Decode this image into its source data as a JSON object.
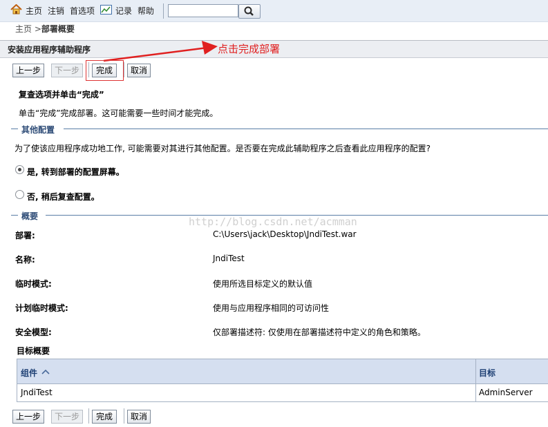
{
  "topnav": {
    "home": "主页",
    "logout": "注销",
    "preferences": "首选项",
    "record": "记录",
    "help": "帮助",
    "search_value": ""
  },
  "breadcrumb": {
    "home": "主页",
    "separator": ">",
    "current": "部署概要"
  },
  "page_title": "安装应用程序辅助程序",
  "annotation": "点击完成部署",
  "buttons": {
    "back": "上一步",
    "next": "下一步",
    "finish": "完成",
    "cancel": "取消"
  },
  "review": {
    "heading": "复查选项并单击“完成”",
    "text": "单击“完成”完成部署。这可能需要一些时间才能完成。"
  },
  "other_config": {
    "legend": "其他配置",
    "question": "为了使该应用程序成功地工作, 可能需要对其进行其他配置。是否要在完成此辅助程序之后查看此应用程序的配置?",
    "option_yes": "是, 转到部署的配置屏幕。",
    "option_no": "否, 稍后复查配置。",
    "selected": "yes"
  },
  "watermark": "http://blog.csdn.net/acmman",
  "summary": {
    "legend": "概要",
    "rows": [
      {
        "label": "部署:",
        "value": "C:\\Users\\jack\\Desktop\\JndiTest.war"
      },
      {
        "label": "名称:",
        "value": "JndiTest"
      },
      {
        "label": "临时模式:",
        "value": "使用所选目标定义的默认值"
      },
      {
        "label": "计划临时模式:",
        "value": "使用与应用程序相同的可访问性"
      },
      {
        "label": "安全模型:",
        "value": "仅部署描述符: 仅使用在部署描述符中定义的角色和策略。"
      }
    ]
  },
  "target_summary": {
    "title": "目标概要",
    "columns": [
      "组件",
      "目标"
    ],
    "rows": [
      {
        "component": "JndiTest",
        "target": "AdminServer"
      }
    ]
  },
  "colors": {
    "annotation": "#e02020",
    "section": "#2e4c77",
    "table_header": "#d5dff0"
  }
}
